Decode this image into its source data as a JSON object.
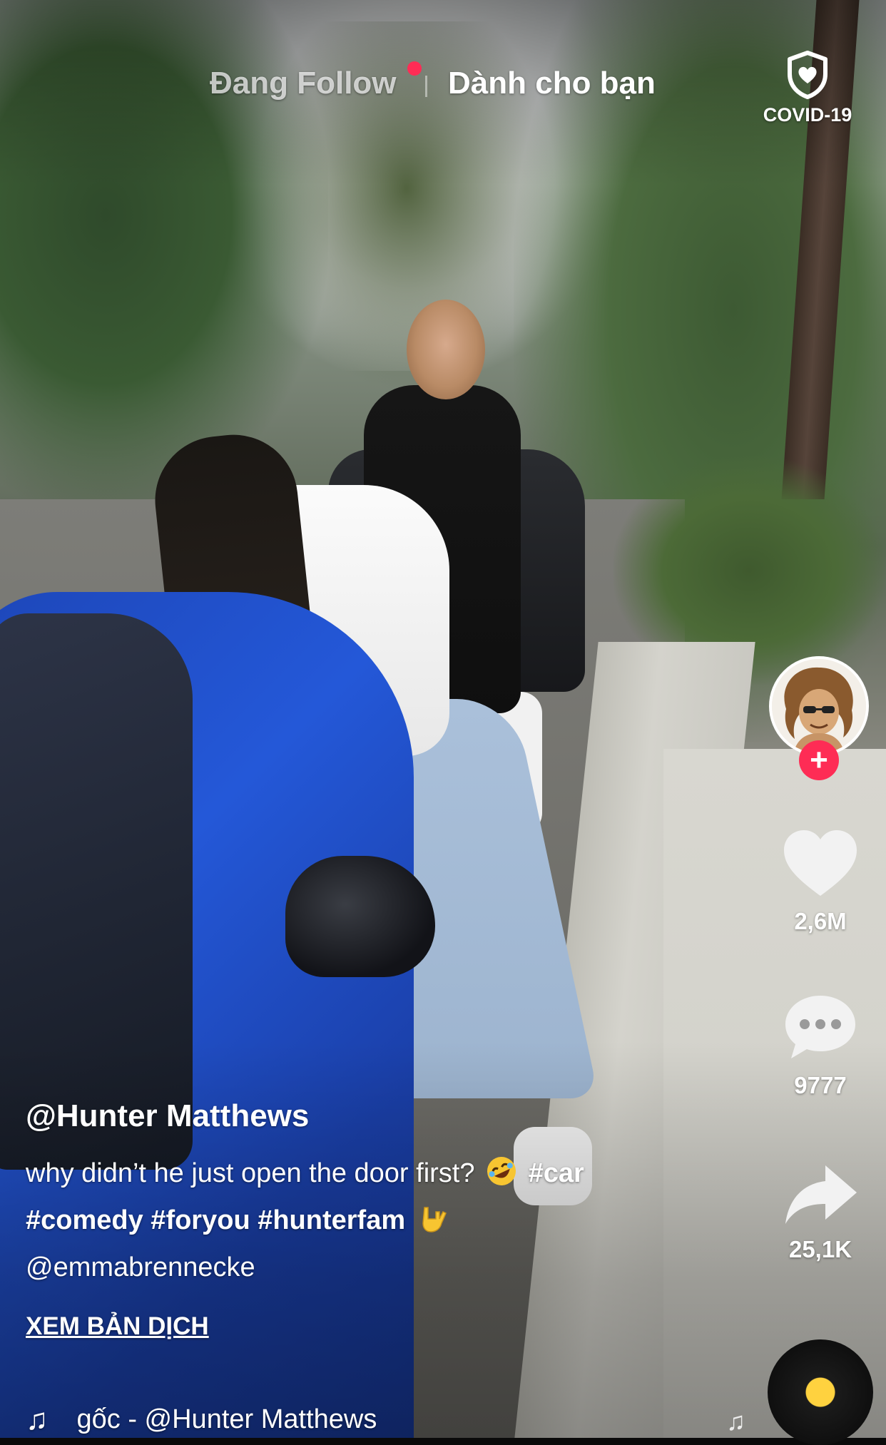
{
  "header": {
    "tab_following": "Đang Follow",
    "tab_for_you": "Dành cho bạn",
    "covid_label": "COVID-19"
  },
  "video": {
    "scene": "street with blue car and two people"
  },
  "actions": {
    "likes": "2,6M",
    "comments": "9777",
    "shares": "25,1K"
  },
  "caption": {
    "username": "@Hunter Matthews",
    "line1_text": "why didn’t he just open the door first?",
    "line1_tag": "#car",
    "line2_tags": "#comedy #foryou #hunterfam",
    "mention": "@emmabrennecke",
    "translate_link": "XEM BẢN DỊCH"
  },
  "sound": {
    "text": "gốc - @Hunter Matthews"
  },
  "icons": {
    "covid": "shield-heart-icon",
    "like": "heart-icon",
    "comment": "comment-dots-icon",
    "share": "share-arrow-icon",
    "music": "music-note-icon",
    "emoji1": "rolling-on-floor-laughing-emoji",
    "emoji2": "love-you-gesture-emoji"
  },
  "colors": {
    "accent": "#fe2c55",
    "disc_center": "#ffd23f"
  }
}
